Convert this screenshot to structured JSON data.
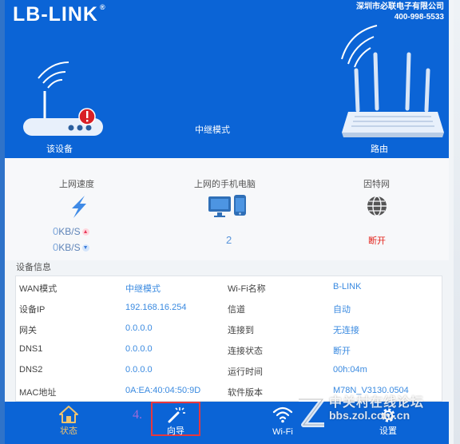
{
  "header": {
    "logo_text": "B-LINK",
    "company_name": "深圳市必联电子有限公司",
    "company_phone": "400-998-5533",
    "mode_label": "中继模式",
    "device_label": "该设备",
    "router_label": "路由"
  },
  "stats": {
    "speed_title": "上网速度",
    "upload_value": "0",
    "download_value": "0",
    "speed_unit": "KB/S",
    "clients_title": "上网的手机电脑",
    "clients_count": "2",
    "internet_title": "因特网",
    "internet_status": "断开"
  },
  "device_info": {
    "title": "设备信息",
    "rows": [
      {
        "label1": "WAN模式",
        "value1": "中继模式",
        "label2": "Wi-Fi名称",
        "value2": "B-LINK"
      },
      {
        "label1": "设备IP",
        "value1": "192.168.16.254",
        "label2": "信道",
        "value2": "自动"
      },
      {
        "label1": "网关",
        "value1": "0.0.0.0",
        "label2": "连接到",
        "value2": "无连接"
      },
      {
        "label1": "DNS1",
        "value1": "0.0.0.0",
        "label2": "连接状态",
        "value2": "断开"
      },
      {
        "label1": "DNS2",
        "value1": "0.0.0.0",
        "label2": "运行时间",
        "value2": "00h:04m"
      },
      {
        "label1": "MAC地址",
        "value1": "0A:EA:40:04:50:9D",
        "label2": "软件版本",
        "value2": "M78N_V3130.0504"
      }
    ]
  },
  "nav": {
    "step_number": "4.",
    "items": [
      {
        "label": "状态",
        "icon": "home-icon"
      },
      {
        "label": "向导",
        "icon": "wand-icon"
      },
      {
        "label": "Wi-Fi",
        "icon": "wifi-icon"
      },
      {
        "label": "设置",
        "icon": "gear-icon"
      }
    ]
  },
  "watermark": {
    "line1": "中关村在线论坛",
    "line2": "bbs.zol.com.cn"
  },
  "colors": {
    "brand_blue": "#0b64d6",
    "value_blue": "#3a8ae0",
    "status_red": "#e3231b",
    "highlight_red": "#e8373d"
  }
}
